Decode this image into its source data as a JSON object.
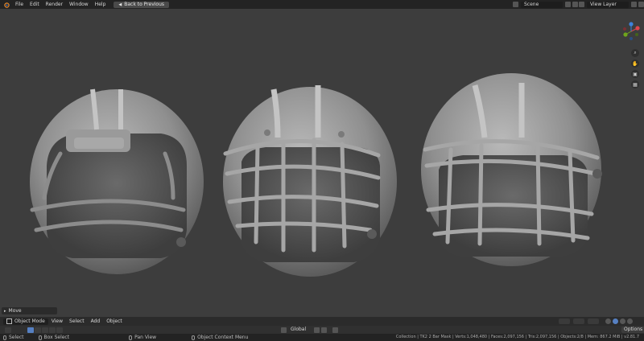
{
  "topbar": {
    "menus": [
      "File",
      "Edit",
      "Render",
      "Window",
      "Help"
    ],
    "back_button": "Back to Previous",
    "scene": "Scene",
    "view_layer": "View Layer"
  },
  "viewport": {
    "operator_panel": "Move",
    "gizmo_axes": {
      "x": "X",
      "y": "Y",
      "z": "Z"
    },
    "colors": {
      "x": "#e0464d",
      "y": "#6fa51b",
      "z": "#3c82dc",
      "bg": "#3d3d3d"
    }
  },
  "header": {
    "mode": "Object Mode",
    "menus": [
      "View",
      "Select",
      "Add",
      "Object"
    ],
    "transform_orientation": "Global",
    "options": "Options"
  },
  "statusbar": {
    "hints": [
      "Select",
      "Box Select",
      "Pan View",
      "Object Context Menu"
    ],
    "stats": "Collection | TK2 2 Bar Mask | Verts:1,048,480 | Faces:2,097,156 | Tris:2,097,156 | Objects:2/8 | Mem: 867.2 MiB | v2.81.7"
  }
}
